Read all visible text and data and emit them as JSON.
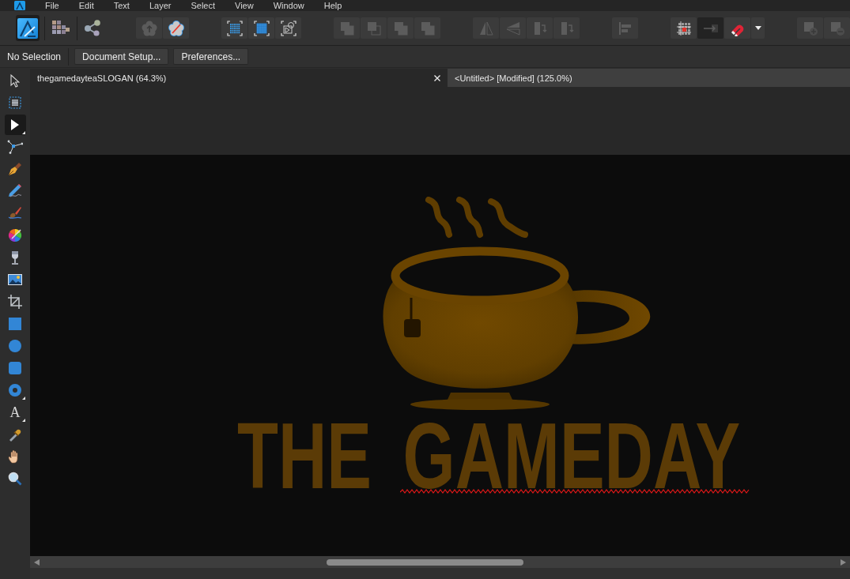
{
  "menu_bar": {
    "items": [
      "File",
      "Edit",
      "Text",
      "Layer",
      "Select",
      "View",
      "Window",
      "Help"
    ]
  },
  "toolbar": {
    "personas": [
      {
        "kind": "designer",
        "selected": true
      },
      {
        "kind": "pixel",
        "selected": false
      },
      {
        "kind": "export",
        "selected": false
      }
    ],
    "groups": [
      {
        "buttons": [
          {
            "kind": "upload-shape",
            "disabled": true,
            "pressed": false
          },
          {
            "kind": "symbol",
            "disabled": false,
            "pressed": false
          }
        ]
      },
      {
        "buttons": [
          {
            "kind": "select-grid",
            "disabled": false,
            "pressed": false
          },
          {
            "kind": "select-bounds",
            "disabled": false,
            "pressed": false
          },
          {
            "kind": "transform-shapes",
            "disabled": false,
            "pressed": false
          }
        ]
      },
      {
        "buttons": [
          {
            "kind": "add",
            "disabled": true,
            "pressed": false
          },
          {
            "kind": "subtract",
            "disabled": true,
            "pressed": false
          },
          {
            "kind": "intersect",
            "disabled": true,
            "pressed": false
          },
          {
            "kind": "divide",
            "disabled": true,
            "pressed": false
          }
        ]
      },
      {
        "buttons": [
          {
            "kind": "flip-horizontal",
            "disabled": true,
            "pressed": false
          },
          {
            "kind": "flip-vertical",
            "disabled": true,
            "pressed": false
          },
          {
            "kind": "rotate-left",
            "disabled": true,
            "pressed": false
          },
          {
            "kind": "rotate-right",
            "disabled": true,
            "pressed": false
          }
        ]
      },
      {
        "buttons": [
          {
            "kind": "align",
            "disabled": true,
            "pressed": false
          }
        ]
      },
      {
        "buttons": [
          {
            "kind": "snap-grid",
            "disabled": false,
            "pressed": false
          },
          {
            "kind": "force-pixel",
            "disabled": false,
            "pressed": true
          },
          {
            "kind": "magnet",
            "disabled": false,
            "pressed": false
          },
          {
            "kind": "dropdown",
            "disabled": false,
            "pressed": false
          }
        ]
      },
      {
        "buttons": [
          {
            "kind": "insert-above",
            "disabled": true,
            "pressed": false
          },
          {
            "kind": "insert-below",
            "disabled": true,
            "pressed": false
          }
        ]
      }
    ]
  },
  "context_bar": {
    "status": "No Selection",
    "buttons": [
      "Document Setup...",
      "Preferences..."
    ]
  },
  "tools": [
    {
      "kind": "move",
      "selected": false,
      "flyout": false
    },
    {
      "kind": "artboard",
      "selected": false,
      "flyout": false
    },
    {
      "kind": "node",
      "selected": true,
      "flyout": true
    },
    {
      "kind": "corner",
      "selected": false,
      "flyout": false
    },
    {
      "kind": "pen",
      "selected": false,
      "flyout": false
    },
    {
      "kind": "pencil",
      "selected": false,
      "flyout": false
    },
    {
      "kind": "brush",
      "selected": false,
      "flyout": false
    },
    {
      "kind": "fill",
      "selected": false,
      "flyout": false
    },
    {
      "kind": "transparency",
      "selected": false,
      "flyout": false
    },
    {
      "kind": "image",
      "selected": false,
      "flyout": false
    },
    {
      "kind": "crop",
      "selected": false,
      "flyout": false
    },
    {
      "kind": "rectangle",
      "selected": false,
      "flyout": false
    },
    {
      "kind": "ellipse",
      "selected": false,
      "flyout": false
    },
    {
      "kind": "rounded-rectangle",
      "selected": false,
      "flyout": false
    },
    {
      "kind": "donut",
      "selected": false,
      "flyout": true
    },
    {
      "kind": "text",
      "glyph": "A",
      "selected": false,
      "flyout": true
    },
    {
      "kind": "color-picker",
      "selected": false,
      "flyout": false
    },
    {
      "kind": "view",
      "selected": false,
      "flyout": false
    },
    {
      "kind": "zoom",
      "selected": false,
      "flyout": false
    }
  ],
  "tabs": [
    {
      "label": "thegamedayteaSLOGAN (64.3%)",
      "selected": true
    },
    {
      "label": "<Untitled> [Modified] (125.0%)",
      "selected": false
    }
  ],
  "document": {
    "headline": "THE GAMEDAY",
    "misspelled": true
  }
}
